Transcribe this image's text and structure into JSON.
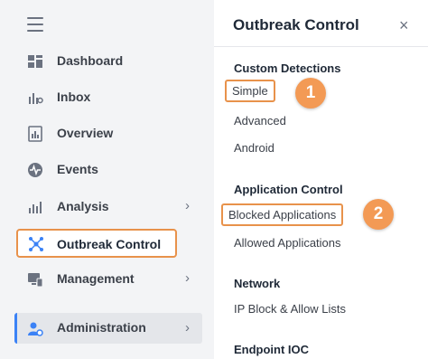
{
  "sidebar": {
    "items": [
      {
        "label": "Dashboard",
        "icon": "dashboard-icon"
      },
      {
        "label": "Inbox",
        "icon": "inbox-icon"
      },
      {
        "label": "Overview",
        "icon": "overview-icon"
      },
      {
        "label": "Events",
        "icon": "events-icon"
      },
      {
        "label": "Analysis",
        "icon": "analysis-icon",
        "chevron": "›"
      },
      {
        "label": "Outbreak Control",
        "icon": "outbreak-control-icon",
        "active": true
      },
      {
        "label": "Management",
        "icon": "management-icon",
        "chevron": "›"
      },
      {
        "label": "Administration",
        "icon": "administration-icon",
        "chevron": "›"
      }
    ]
  },
  "panel": {
    "title": "Outbreak Control",
    "close": "×",
    "sections": [
      {
        "heading": "Custom Detections",
        "links": [
          "Simple",
          "Advanced",
          "Android"
        ]
      },
      {
        "heading": "Application Control",
        "links": [
          "Blocked Applications",
          "Allowed Applications"
        ]
      },
      {
        "heading": "Network",
        "links": [
          "IP Block & Allow Lists"
        ]
      },
      {
        "heading": "Endpoint IOC",
        "links": []
      }
    ]
  },
  "callouts": [
    "1",
    "2"
  ],
  "colors": {
    "highlight": "#e8924b",
    "callout": "#f39a55",
    "admin_accent": "#3b82f6"
  }
}
